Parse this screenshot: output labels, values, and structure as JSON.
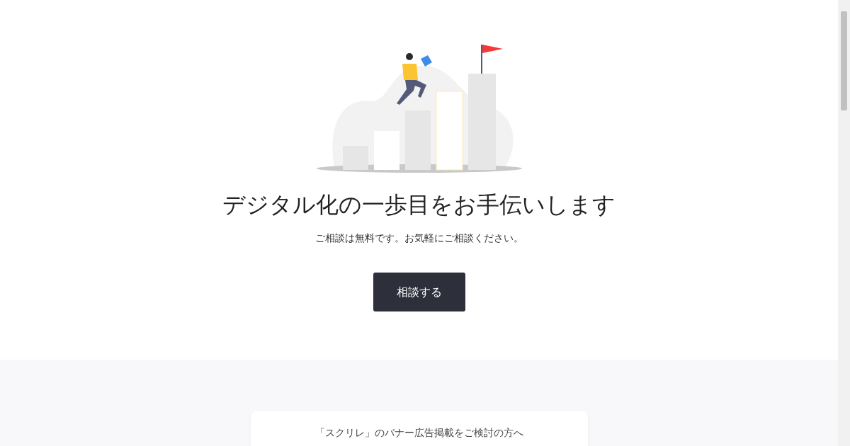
{
  "hero": {
    "title": "デジタル化の一歩目をお手伝いします",
    "subtitle": "ご相談は無料です。お気軽にご相談ください。",
    "button": "相談する"
  },
  "banner_card": {
    "title": "「スクリレ」のバナー広告掲載をご検討の方へ"
  }
}
